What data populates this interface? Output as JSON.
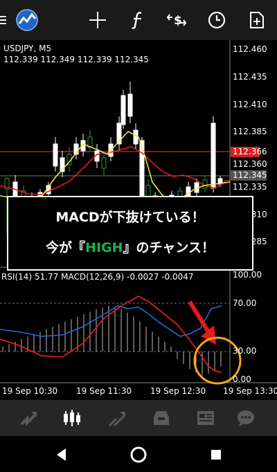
{
  "header": {
    "symbol": "USDJPY, M5",
    "quotes": "112.339 112.349 112.339 112.345"
  },
  "price_axis": [
    "112.460",
    "112.435",
    "112.410",
    "112.385",
    "112.360",
    "112.335",
    "112.310",
    "112.285"
  ],
  "price_tags": {
    "red": "112.366",
    "gray": "112.345"
  },
  "indicator": {
    "label": "RSI(14) 51.77 MACD(12,26,9) -0.0027 -0.0047",
    "levels": [
      "100.00",
      "70.00",
      "30.00",
      "0.00"
    ]
  },
  "time_axis": [
    "19 Sep 10:30",
    "19 Sep 11:30",
    "19 Sep 12:30",
    "19 Sep 13:30"
  ],
  "overlay": {
    "line1": "MACDが下抜けている！",
    "line2_pre": "今が『",
    "line2_highlight": "HIGH",
    "line2_post": "』のチャンス！"
  },
  "toolbar_icons": [
    "menu-icon",
    "app-logo-icon",
    "crosshair-icon",
    "function-icon",
    "dollar-swap-icon",
    "clock-icon",
    "add-file-icon"
  ],
  "bottom_nav": [
    "quotes-icon",
    "chart-icon",
    "trade-icon",
    "history-icon",
    "news-icon",
    "chat-icon"
  ],
  "colors": {
    "highlight": "#17b354",
    "red_line": "#e21b1b",
    "yellow_line": "#f0e64a",
    "rsi_line": "#1f6fd6",
    "annotation": "#f2a81d"
  }
}
